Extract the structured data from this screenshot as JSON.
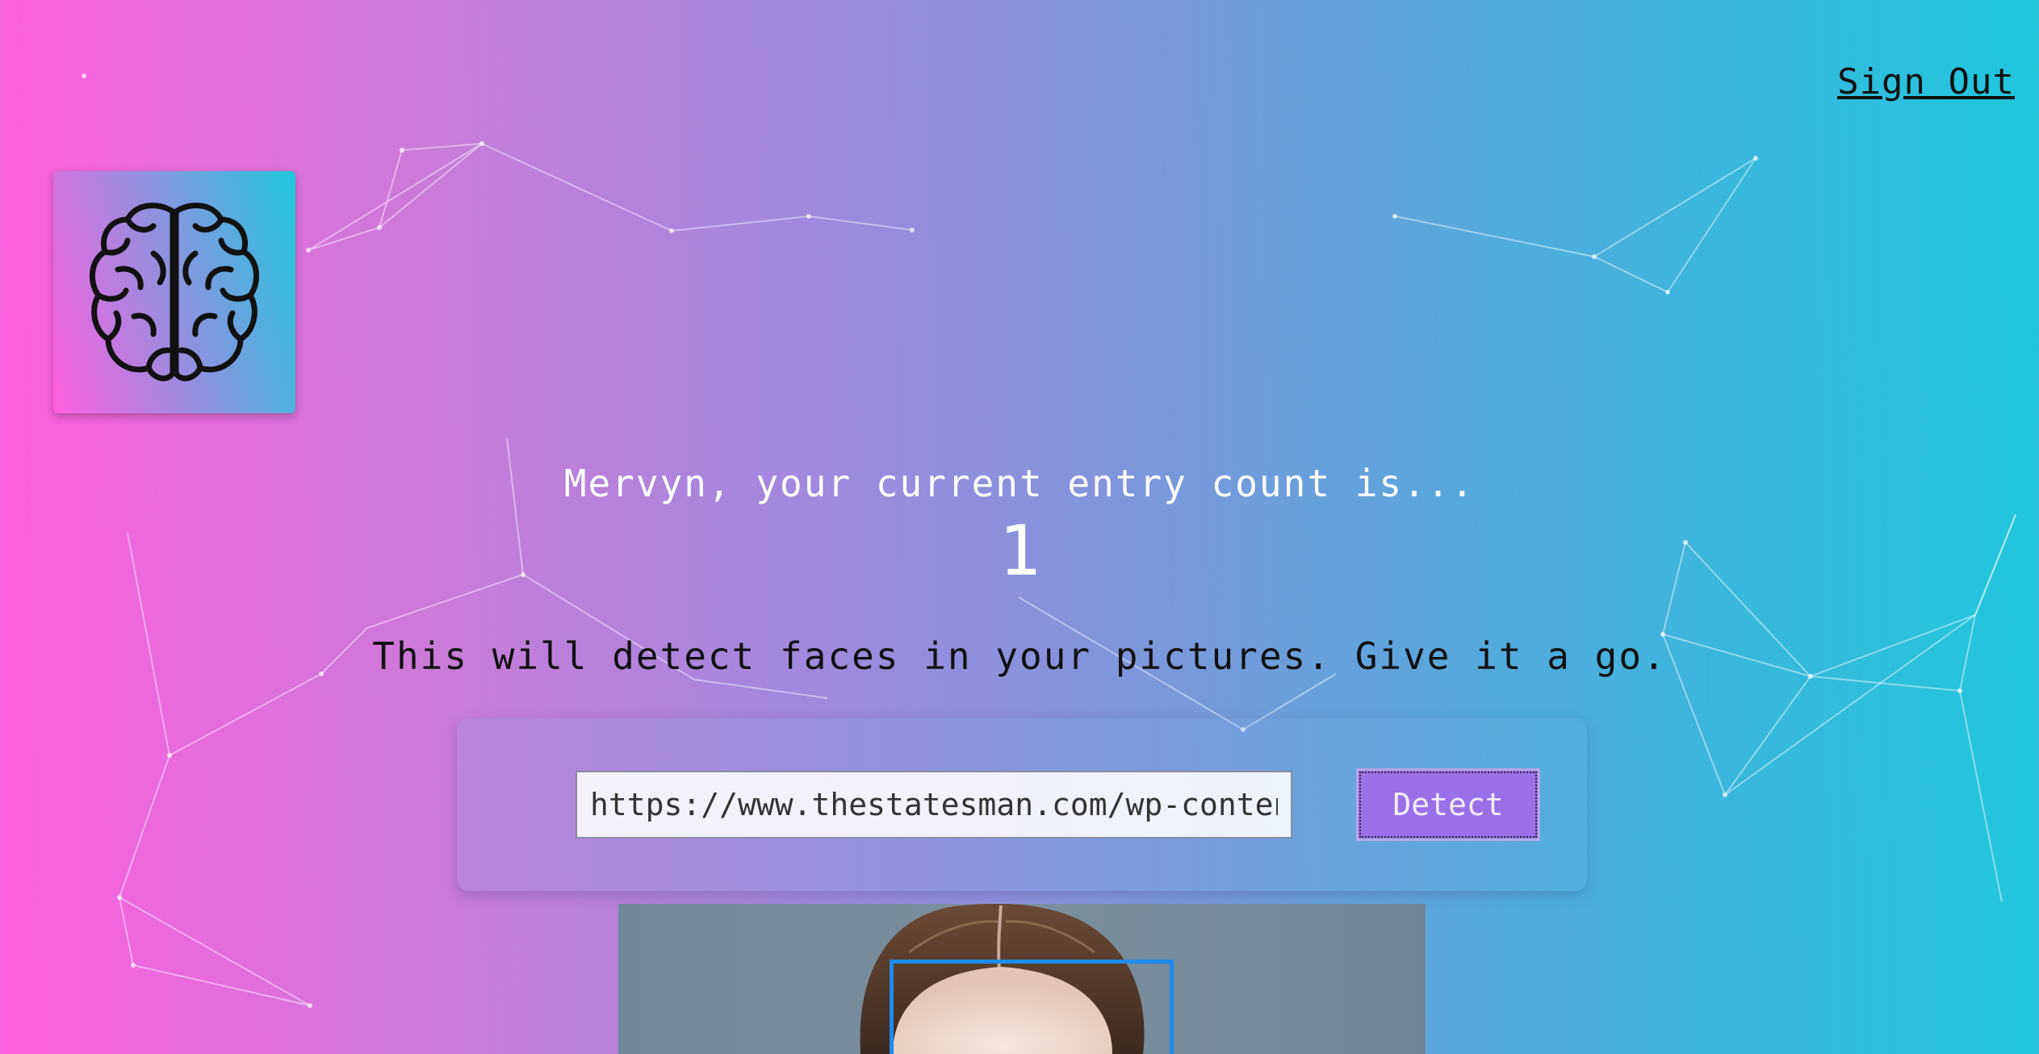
{
  "header": {
    "sign_out_label": "Sign Out"
  },
  "logo": {
    "icon": "brain-icon"
  },
  "rank": {
    "greeting": "Mervyn, your current entry count is...",
    "count": "1"
  },
  "description": "This will detect faces in your pictures. Give it a go.",
  "form": {
    "url_value": "https://www.thestatesman.com/wp-content",
    "detect_label": "Detect"
  },
  "colors": {
    "gradient_start": "#ff5edf",
    "gradient_end": "#1fc7de",
    "detect_button": "#9a6fe8",
    "face_box": "#1e8bf0"
  }
}
